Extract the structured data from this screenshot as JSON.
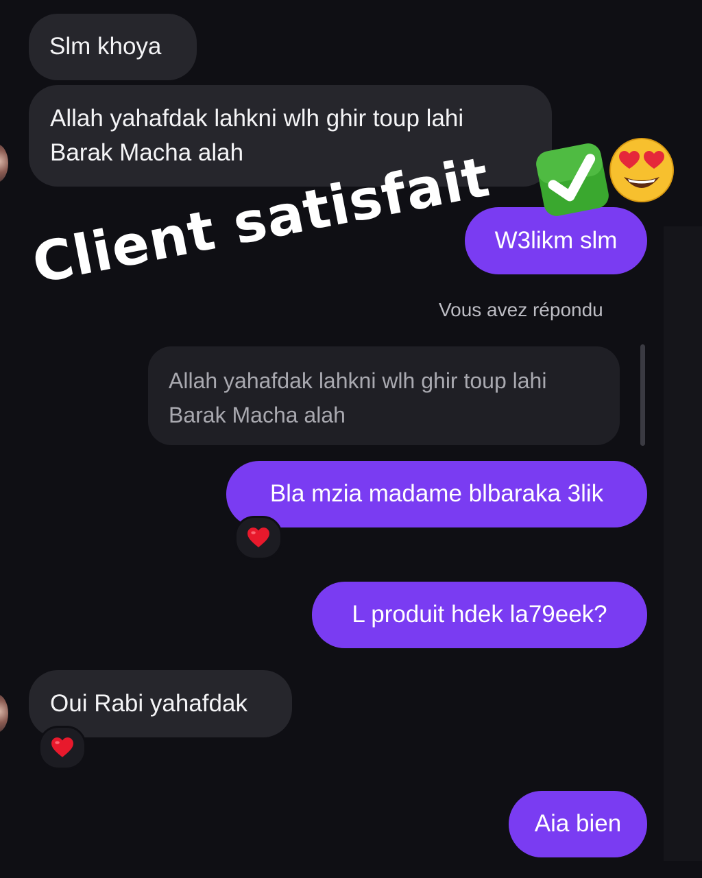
{
  "messages": {
    "m1": "Slm khoya",
    "m2_line1": "Allah yahafdak lahkni wlh ghir toup lahi",
    "m2_line2": "Barak Macha alah",
    "m3": "W3likm slm",
    "reply_label": "Vous avez répondu",
    "quoted_line1": "Allah yahafdak lahkni wlh ghir toup lahi",
    "quoted_line2": "Barak Macha alah",
    "m4": "Bla mzia madame blbaraka 3lik",
    "m5": "L produit hdek la79eek?",
    "m6": "Oui Rabi yahafdak",
    "m7": "Aia bien"
  },
  "overlay": {
    "text": "Client satisfait"
  },
  "colors": {
    "outgoing": "#7a3cf2",
    "incoming": "#26262c",
    "background": "#0f0f14",
    "reaction_heart": "#e8192c"
  },
  "icons": {
    "reaction": "red-heart-icon",
    "sticker_check": "check-mark-button-icon",
    "sticker_face": "heart-eyes-face-icon"
  }
}
